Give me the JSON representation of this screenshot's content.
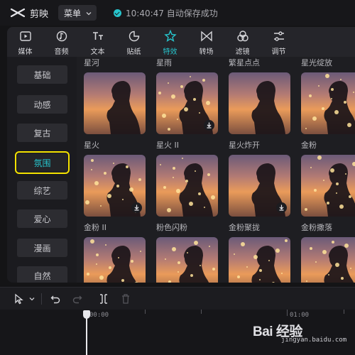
{
  "app": {
    "name": "剪映",
    "menu_label": "菜单",
    "save_status": "10:40:47 自动保存成功"
  },
  "toolbar": {
    "tabs": [
      {
        "label": "媒体",
        "icon": "media-icon"
      },
      {
        "label": "音频",
        "icon": "audio-icon"
      },
      {
        "label": "文本",
        "icon": "text-icon"
      },
      {
        "label": "贴纸",
        "icon": "sticker-icon"
      },
      {
        "label": "特效",
        "icon": "effects-icon",
        "active": true
      },
      {
        "label": "转场",
        "icon": "transition-icon"
      },
      {
        "label": "滤镜",
        "icon": "filter-icon"
      },
      {
        "label": "调节",
        "icon": "adjust-icon"
      }
    ]
  },
  "categories": [
    {
      "label": "基础"
    },
    {
      "label": "动感"
    },
    {
      "label": "复古"
    },
    {
      "label": "氛围",
      "active": true
    },
    {
      "label": "综艺"
    },
    {
      "label": "爱心"
    },
    {
      "label": "漫画"
    },
    {
      "label": "自然"
    }
  ],
  "effects": {
    "row1": [
      "星河",
      "星雨",
      "繁星点点",
      "星光绽放"
    ],
    "row2": [
      "星火",
      "星火 II",
      "星火炸开",
      "金粉"
    ],
    "row3": [
      "金粉 II",
      "粉色闪粉",
      "金粉聚拢",
      "金粉撒落"
    ]
  },
  "timeline": {
    "ruler_start": "00:00",
    "ruler_mark": "01:00"
  },
  "watermark": {
    "brand": "Bai 经验",
    "url": "jingyan.baidu.com"
  },
  "colors": {
    "accent": "#27c4cc",
    "highlight_box": "#f4e200",
    "bg": "#141416"
  }
}
